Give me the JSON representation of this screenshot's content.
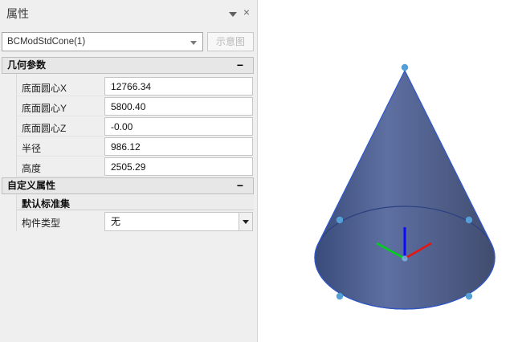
{
  "panel": {
    "title": "属性",
    "object_selector": {
      "value": "BCModStdCone(1)"
    },
    "schematic_button_label": "示意图",
    "geometry": {
      "header": "几何参数",
      "collapse_glyph": "−",
      "rows": [
        {
          "label": "底面圆心X",
          "value": "12766.34"
        },
        {
          "label": "底面圆心Y",
          "value": "5800.40"
        },
        {
          "label": "底面圆心Z",
          "value": "-0.00"
        },
        {
          "label": "半径",
          "value": "986.12"
        },
        {
          "label": "高度",
          "value": "2505.29"
        }
      ]
    },
    "custom": {
      "header": "自定义属性",
      "collapse_glyph": "−",
      "standard_set_header": "默认标准集",
      "rows": [
        {
          "label": "构件类型",
          "value": "无"
        }
      ]
    }
  },
  "titlebar_icons": {
    "close_glyph": "×"
  },
  "viewport": {
    "object": "cone-3d-preview",
    "cone_gradient": [
      "#3b4d7c",
      "#5e6fa1",
      "#566796",
      "#424d70"
    ],
    "outline_color": "#3058c8",
    "back_rim_color": "#2b4080",
    "handle_color": "#54a0d6",
    "origin_handle_color": "#7cb5e4",
    "axis_colors": {
      "x": "#e81414",
      "y": "#00d01c",
      "z": "#0a0aff"
    }
  }
}
